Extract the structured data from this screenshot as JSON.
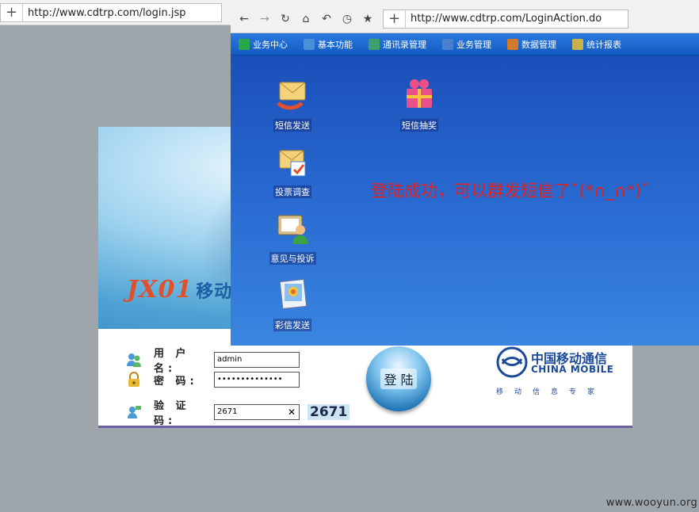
{
  "back_window": {
    "url": "http://www.cdtrp.com/login.jsp",
    "login": {
      "username_label": "用 户 名:",
      "username_value": "admin",
      "password_label": "密    码:",
      "password_value": "••••••••••••••",
      "captcha_label": "验 证 码:",
      "captcha_value": "2671",
      "captcha_image_text": "2671",
      "login_button": "登 陆"
    },
    "banner": {
      "logo_text": "JX01",
      "logo_cn": "移动信"
    },
    "china_mobile": {
      "cn": "中国移动通信",
      "en": "CHINA MOBILE",
      "slogan": "移动信息专家"
    }
  },
  "front_window": {
    "url": "http://www.cdtrp.com/LoginAction.do",
    "menu": [
      {
        "label": "业务中心",
        "icon": "business-center-icon",
        "color": "#27a84a"
      },
      {
        "label": "基本功能",
        "icon": "basic-function-icon",
        "color": "#4a8fd8"
      },
      {
        "label": "通讯录管理",
        "icon": "address-book-icon",
        "color": "#3ea06a"
      },
      {
        "label": "业务管理",
        "icon": "business-manage-icon",
        "color": "#4a7fd0"
      },
      {
        "label": "数据管理",
        "icon": "data-manage-icon",
        "color": "#d07a2a"
      },
      {
        "label": "统计报表",
        "icon": "statistics-report-icon",
        "color": "#c8b24a"
      }
    ],
    "apps": [
      {
        "label": "短信发送",
        "icon": "sms-send-icon"
      },
      {
        "label": "短信抽奖",
        "icon": "sms-lottery-icon"
      },
      {
        "label": "投票调查",
        "icon": "vote-survey-icon"
      },
      {
        "label": "意见与投诉",
        "icon": "feedback-complaint-icon"
      },
      {
        "label": "彩信发送",
        "icon": "mms-send-icon"
      }
    ],
    "success_message": "登陆成功，可以群发短信了ˇ(*∩_∩*)ˇ"
  },
  "watermark": "www.wooyun.org",
  "colors": {
    "success_text": "#e12121",
    "content_bg": "#1c63c4",
    "china_mobile_blue": "#1b4a9a"
  }
}
